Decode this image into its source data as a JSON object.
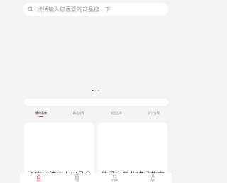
{
  "search": {
    "placeholder": "试试输入您喜爱的商品搜一下"
  },
  "carousel": {
    "total": 3,
    "active_index": 0
  },
  "tabs": [
    {
      "label": "猜你喜欢",
      "active": true
    },
    {
      "label": "精品推荐",
      "active": false
    },
    {
      "label": "新品直降",
      "active": false
    },
    {
      "label": "好评推荐",
      "active": false
    }
  ],
  "products": [
    {
      "title": "酒店家纺床上用品全..."
    },
    {
      "title": "休闲家居北欧风格布艺..."
    }
  ],
  "tabbar": [
    {
      "label": "首页",
      "icon": "home-icon",
      "active": true
    },
    {
      "label": "分类",
      "icon": "category-icon",
      "active": false
    },
    {
      "label": "购物车",
      "icon": "cart-icon",
      "active": false
    },
    {
      "label": "我的",
      "icon": "user-icon",
      "active": false
    }
  ],
  "colors": {
    "accent": "#e6354a",
    "background": "#f4f4f4"
  }
}
